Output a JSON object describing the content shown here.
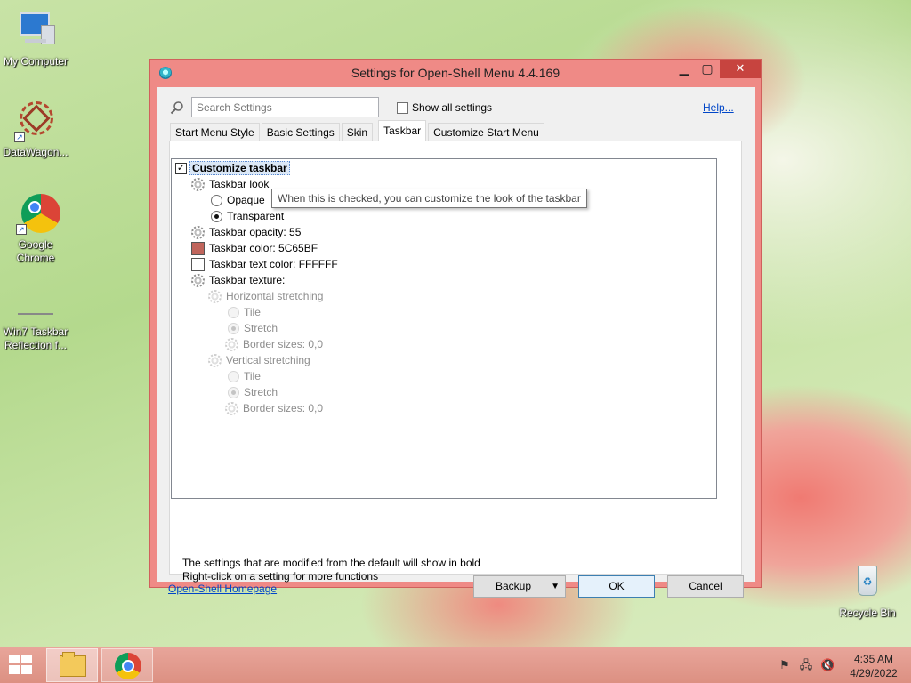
{
  "desktop": {
    "icons": [
      {
        "label": "My Computer"
      },
      {
        "label": "DataWagon..."
      },
      {
        "label": "Google Chrome"
      },
      {
        "label": "Win7 Taskbar Reflection f..."
      },
      {
        "label": "Recycle Bin"
      }
    ]
  },
  "window": {
    "title": "Settings for Open-Shell Menu 4.4.169",
    "controls": {
      "minimize": "▁",
      "maximize": "▢",
      "close": "✕"
    },
    "search_placeholder": "Search Settings",
    "show_all_label": "Show all settings",
    "show_all_checked": false,
    "help_link": "Help...",
    "tabs": [
      {
        "label": "Start Menu Style",
        "active": false
      },
      {
        "label": "Basic Settings",
        "active": false
      },
      {
        "label": "Skin",
        "active": false
      },
      {
        "label": "Taskbar",
        "active": true
      },
      {
        "label": "Customize Start Menu",
        "active": false
      }
    ],
    "settings": [
      {
        "label": "Customize taskbar",
        "kind": "checkbox",
        "checked": true
      },
      {
        "label": "Taskbar look",
        "kind": "gear"
      },
      {
        "label": "Opaque",
        "kind": "radio",
        "selected": false
      },
      {
        "label": "Transparent",
        "kind": "radio",
        "selected": true
      },
      {
        "label": "Taskbar opacity: 55",
        "kind": "gear"
      },
      {
        "label": "Taskbar color: 5C65BF",
        "kind": "color",
        "color": "#c0655c"
      },
      {
        "label": "Taskbar text color: FFFFFF",
        "kind": "color",
        "color": "#ffffff"
      },
      {
        "label": "Taskbar texture:",
        "kind": "gear"
      },
      {
        "label": "Horizontal stretching",
        "kind": "gear",
        "disabled": true
      },
      {
        "label": "Tile",
        "kind": "radio",
        "selected": false,
        "disabled": true
      },
      {
        "label": "Stretch",
        "kind": "radio",
        "selected": true,
        "disabled": true
      },
      {
        "label": "Border sizes: 0,0",
        "kind": "gear",
        "disabled": true
      },
      {
        "label": "Vertical stretching",
        "kind": "gear",
        "disabled": true
      },
      {
        "label": "Tile",
        "kind": "radio",
        "selected": false,
        "disabled": true
      },
      {
        "label": "Stretch",
        "kind": "radio",
        "selected": true,
        "disabled": true
      },
      {
        "label": "Border sizes: 0,0",
        "kind": "gear",
        "disabled": true
      }
    ],
    "tooltip": "When this is checked, you can customize the look of the taskbar",
    "note_bold": "The settings that are modified from the default will show in bold",
    "note_right_click": "Right-click on a setting for more functions",
    "homepage_link": "Open-Shell Homepage",
    "buttons": {
      "backup": "Backup",
      "ok": "OK",
      "cancel": "Cancel"
    }
  },
  "taskbar": {
    "time": "4:35 AM",
    "date": "4/29/2022"
  }
}
